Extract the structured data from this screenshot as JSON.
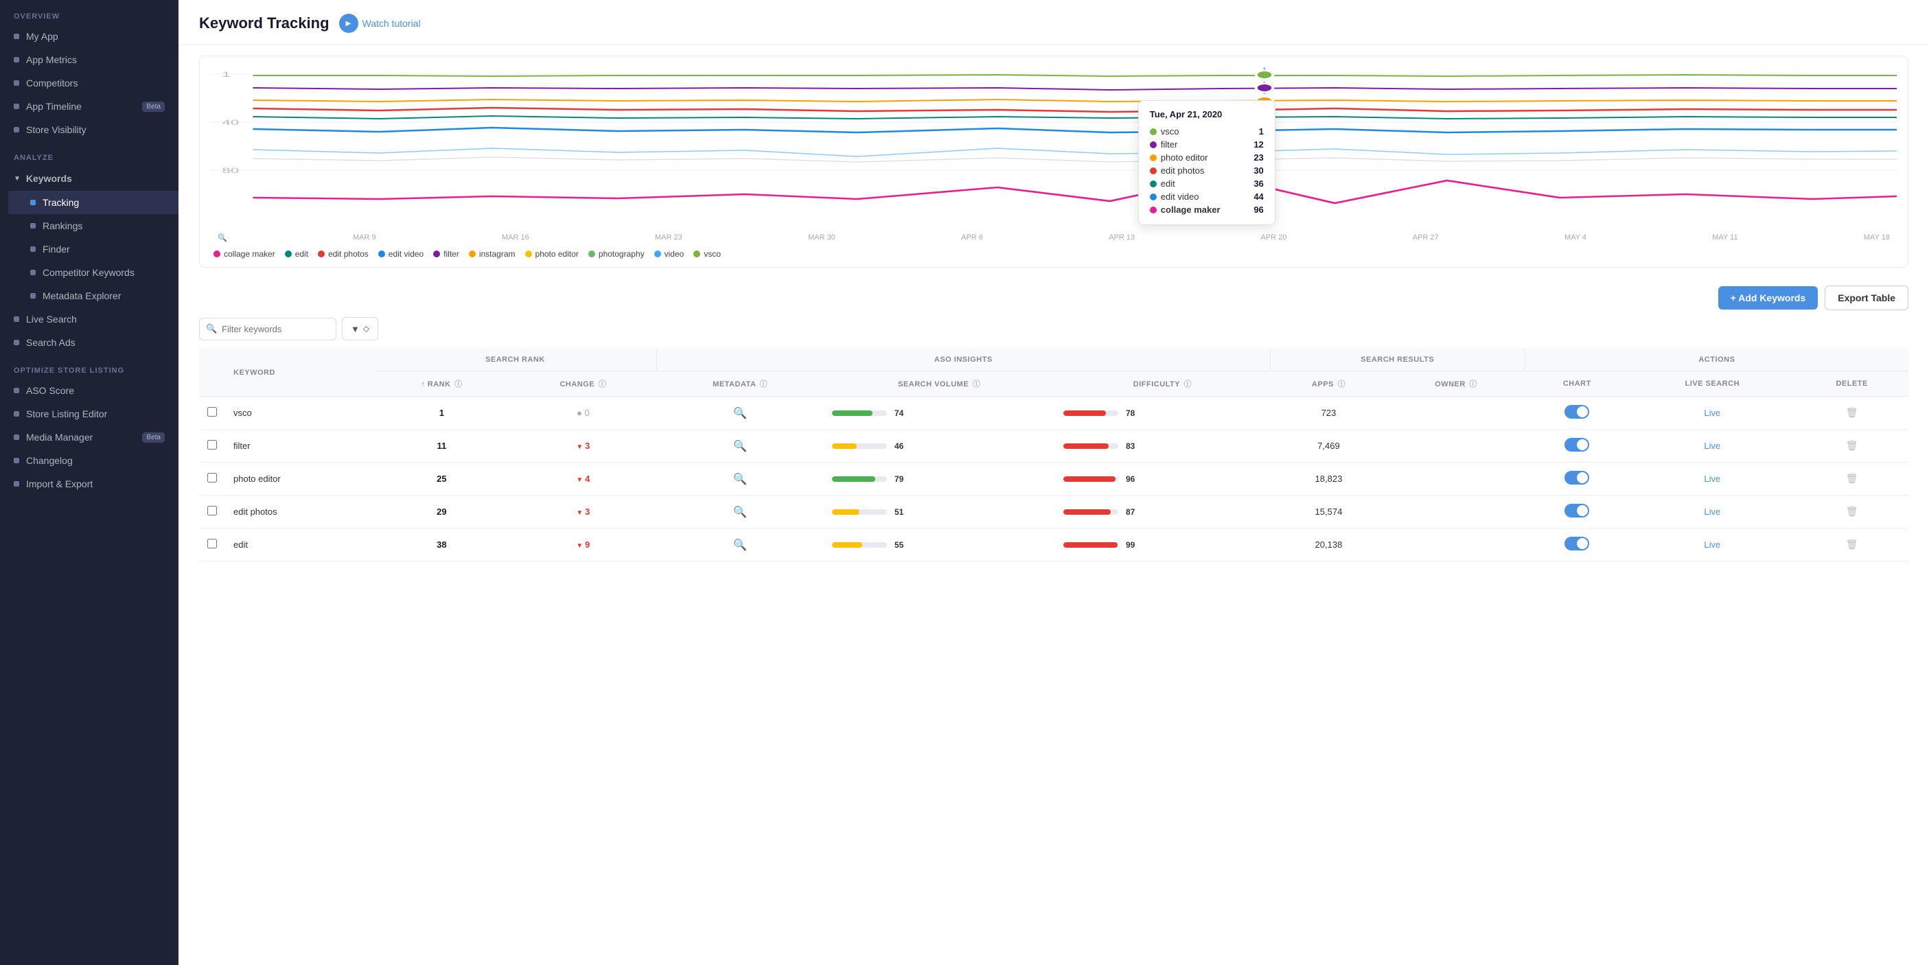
{
  "sidebar": {
    "overview_label": "OVERVIEW",
    "analyze_label": "ANALYZE",
    "optimize_label": "OPTIMIZE STORE LISTING",
    "items_overview": [
      {
        "label": "My App",
        "name": "my-app"
      },
      {
        "label": "App Metrics",
        "name": "app-metrics"
      },
      {
        "label": "Competitors",
        "name": "competitors"
      },
      {
        "label": "App Timeline",
        "name": "app-timeline",
        "badge": "Beta"
      },
      {
        "label": "Store Visibility",
        "name": "store-visibility"
      }
    ],
    "keywords_category": "Keywords",
    "keywords_sub": [
      {
        "label": "Tracking",
        "name": "tracking",
        "active": true
      },
      {
        "label": "Rankings",
        "name": "rankings"
      },
      {
        "label": "Finder",
        "name": "finder"
      },
      {
        "label": "Competitor Keywords",
        "name": "competitor-keywords"
      },
      {
        "label": "Metadata Explorer",
        "name": "metadata-explorer"
      }
    ],
    "items_analyze_other": [
      {
        "label": "Live Search",
        "name": "live-search"
      },
      {
        "label": "Search Ads",
        "name": "search-ads"
      }
    ],
    "items_optimize": [
      {
        "label": "ASO Score",
        "name": "aso-score"
      },
      {
        "label": "Store Listing Editor",
        "name": "store-listing-editor"
      },
      {
        "label": "Media Manager",
        "name": "media-manager",
        "badge": "Beta"
      },
      {
        "label": "Changelog",
        "name": "changelog"
      },
      {
        "label": "Import & Export",
        "name": "import-export"
      }
    ]
  },
  "header": {
    "title": "Keyword Tracking",
    "tutorial_label": "Watch tutorial"
  },
  "chart": {
    "y_labels": [
      "1",
      "40",
      "80"
    ],
    "x_labels": [
      "MAR 9",
      "MAR 16",
      "MAR 23",
      "MAR 30",
      "APR 6",
      "APR 13",
      "APR 20",
      "APR 27",
      "MAY 4",
      "MAY 11",
      "MAY 18"
    ],
    "tooltip": {
      "date": "Tue, Apr 21, 2020",
      "rows": [
        {
          "label": "vsco",
          "value": "1",
          "color": "#7cb342"
        },
        {
          "label": "filter",
          "value": "12",
          "color": "#7b1fa2"
        },
        {
          "label": "photo editor",
          "value": "23",
          "color": "#ffa000"
        },
        {
          "label": "edit photos",
          "value": "30",
          "color": "#e53935"
        },
        {
          "label": "edit",
          "value": "36",
          "color": "#00897b"
        },
        {
          "label": "edit video",
          "value": "44",
          "color": "#1e88e5"
        },
        {
          "label": "collage maker",
          "value": "96",
          "bold": true,
          "color": "#e91e8c"
        }
      ]
    },
    "legend": [
      {
        "label": "collage maker",
        "color": "#e91e8c"
      },
      {
        "label": "edit",
        "color": "#00897b"
      },
      {
        "label": "edit photos",
        "color": "#e53935"
      },
      {
        "label": "edit video",
        "color": "#1e88e5"
      },
      {
        "label": "filter",
        "color": "#7b1fa2"
      },
      {
        "label": "instagram",
        "color": "#ffa000"
      },
      {
        "label": "photo editor",
        "color": "#ffc107"
      },
      {
        "label": "photography",
        "color": "#66bb6a"
      },
      {
        "label": "video",
        "color": "#42a5f5"
      },
      {
        "label": "vsco",
        "color": "#7cb342"
      }
    ]
  },
  "table_controls": {
    "add_keywords_label": "+ Add Keywords",
    "export_label": "Export Table"
  },
  "search": {
    "placeholder": "Filter keywords"
  },
  "table": {
    "col_groups": [
      {
        "label": "SEARCH RANK",
        "colspan": 2
      },
      {
        "label": "ASO INSIGHTS",
        "colspan": 3
      },
      {
        "label": "SEARCH RESULTS",
        "colspan": 2
      },
      {
        "label": "ACTIONS",
        "colspan": 3
      }
    ],
    "columns": [
      {
        "label": "KEYWORD"
      },
      {
        "label": "↑ RANK",
        "info": true
      },
      {
        "label": "CHANGE",
        "info": true
      },
      {
        "label": "METADATA",
        "info": true
      },
      {
        "label": "SEARCH VOLUME",
        "info": true
      },
      {
        "label": "DIFFICULTY",
        "info": true
      },
      {
        "label": "APPS",
        "info": true
      },
      {
        "label": "OWNER",
        "info": true
      },
      {
        "label": "CHART"
      },
      {
        "label": "LIVE SEARCH"
      },
      {
        "label": "DELETE"
      }
    ],
    "rows": [
      {
        "keyword": "vsco",
        "rank": "1",
        "change": "0",
        "change_type": "neutral",
        "search_volume": 74,
        "search_volume_color": "green",
        "difficulty": 78,
        "difficulty_color": "red",
        "apps": "723",
        "chart_on": true,
        "live": "Live"
      },
      {
        "keyword": "filter",
        "rank": "11",
        "change": "3",
        "change_type": "down",
        "search_volume": 46,
        "search_volume_color": "yellow",
        "difficulty": 83,
        "difficulty_color": "red",
        "apps": "7,469",
        "chart_on": true,
        "live": "Live"
      },
      {
        "keyword": "photo editor",
        "rank": "25",
        "change": "4",
        "change_type": "down",
        "search_volume": 79,
        "search_volume_color": "green",
        "difficulty": 96,
        "difficulty_color": "red",
        "apps": "18,823",
        "chart_on": true,
        "live": "Live"
      },
      {
        "keyword": "edit photos",
        "rank": "29",
        "change": "3",
        "change_type": "down",
        "search_volume": 51,
        "search_volume_color": "yellow",
        "difficulty": 87,
        "difficulty_color": "red",
        "apps": "15,574",
        "chart_on": true,
        "live": "Live"
      },
      {
        "keyword": "edit",
        "rank": "38",
        "change": "9",
        "change_type": "down",
        "search_volume": 55,
        "search_volume_color": "yellow",
        "difficulty": 99,
        "difficulty_color": "red",
        "apps": "20,138",
        "chart_on": true,
        "live": "Live"
      }
    ]
  }
}
